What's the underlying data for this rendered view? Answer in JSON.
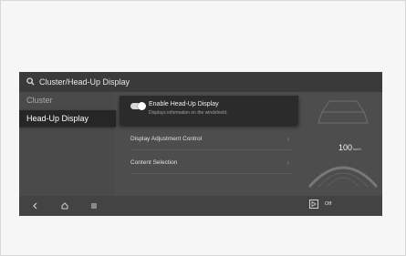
{
  "header": {
    "title": "Cluster/Head-Up Display"
  },
  "sidebar": {
    "items": [
      {
        "label": "Cluster"
      },
      {
        "label": "Head-Up Display"
      }
    ]
  },
  "settings": {
    "enable_hud": {
      "title": "Enable Head-Up Display",
      "subtitle": "Displays information on the windshield.",
      "enabled": true
    },
    "rows": [
      {
        "label": "Display Adjustment Control"
      },
      {
        "label": "Content Selection"
      }
    ]
  },
  "preview": {
    "speed": "100",
    "unit": "km/h"
  },
  "bottombar": {
    "off_label": "Off"
  },
  "icons": [
    "search-icon",
    "back-icon",
    "home-icon",
    "menu-icon",
    "play-icon",
    "chevron-right-icon"
  ],
  "colors": {
    "screen_bg": "#4d4d4d",
    "card_bg": "#2b2b2b",
    "active_bg": "#262626"
  }
}
